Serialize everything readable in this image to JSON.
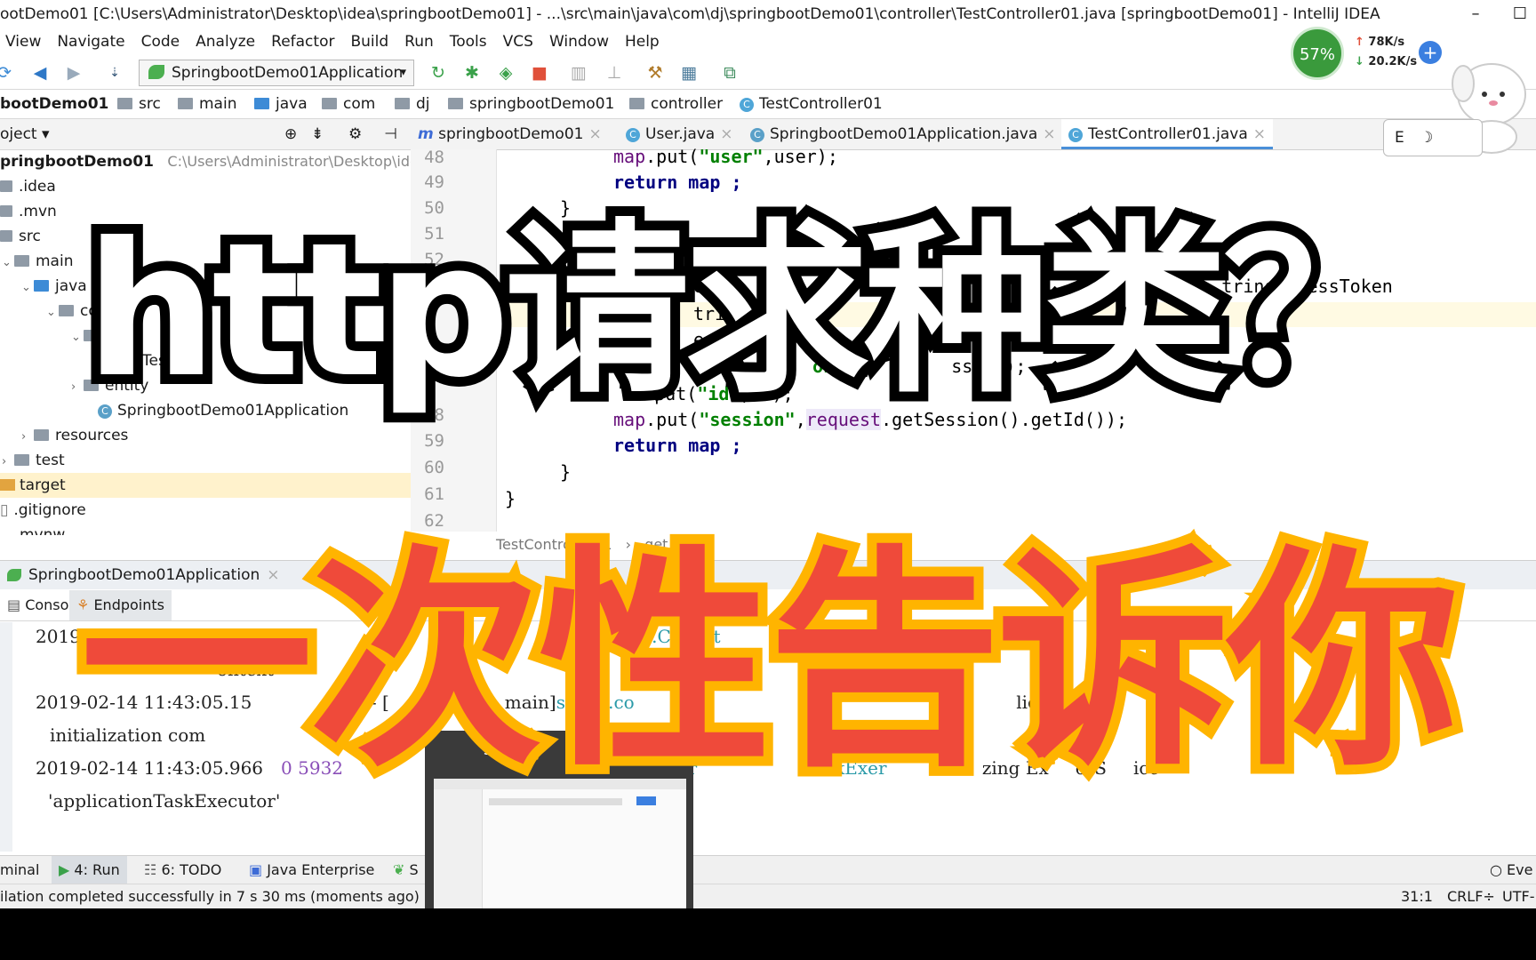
{
  "window": {
    "title": "ootDemo01 [C:\\Users\\Administrator\\Desktop\\idea\\springbootDemo01] - ...\\src\\main\\java\\com\\dj\\springbootDemo01\\controller\\TestController01.java [springbootDemo01] - IntelliJ IDEA"
  },
  "menu": [
    "View",
    "Navigate",
    "Code",
    "Analyze",
    "Refactor",
    "Build",
    "Run",
    "Tools",
    "VCS",
    "Window",
    "Help"
  ],
  "toolbar": {
    "run_config": "SpringbootDemo01Application"
  },
  "breadcrumbs": [
    "bootDemo01",
    "src",
    "main",
    "java",
    "com",
    "dj",
    "springbootDemo01",
    "controller",
    "TestController01"
  ],
  "project_panel": {
    "title": "oject",
    "tree": [
      {
        "label": "pringbootDemo01",
        "path": "C:\\Users\\Administrator\\Desktop\\ide"
      },
      {
        "label": ".idea"
      },
      {
        "label": ".mvn"
      },
      {
        "label": "src"
      },
      {
        "label": "main"
      },
      {
        "label": "java"
      },
      {
        "label": "co"
      },
      {
        "label": "ntro"
      },
      {
        "label": "Tes"
      },
      {
        "label": "entity"
      },
      {
        "label": "SpringbootDemo01Application"
      },
      {
        "label": "resources"
      },
      {
        "label": "test"
      },
      {
        "label": "target"
      },
      {
        "label": ".gitignore"
      },
      {
        "label": "mvnw"
      }
    ]
  },
  "editor": {
    "tabs": [
      "springbootDemo01",
      "User.java",
      "SpringbootDemo01Application.java",
      "TestController01.java"
    ],
    "active_tab": "TestController01.java",
    "line_numbers": [
      "48",
      "49",
      "50",
      "51",
      "52",
      "53",
      "54",
      "55",
      "56",
      "57",
      "58",
      "59",
      "60",
      "61",
      "62"
    ],
    "code": {
      "l48_a": "map",
      "l48_b": ".put(",
      "l48_c": "\"user\"",
      "l48_d": ",user);",
      "l49_kw": "return",
      "l49_b": " map ;",
      "l50": "}",
      "l52": "g(p",
      "l52_b": "He",
      "l53": "ect",
      "l53_b": "equ",
      "l53_c": "e",
      "l53_d": "tring",
      "l53_e": "essToken",
      "l54": "trin",
      "l54_b": "Ses",
      "l54_c": "ed",
      "l54_d": "t",
      "l55": "ear(",
      "l56": "t(",
      "l56_b": "oke",
      "l56_c": "ssi",
      "l56_d": ");",
      "l57_a": "ma",
      "l57_b": ".put(",
      "l57_c": "\"id\"",
      "l57_d": ",id);",
      "l58_a": "map",
      "l58_b": ".put(",
      "l58_c": "\"session\"",
      "l58_d": ",",
      "l58_e": "request",
      "l58_f": ".getSession().getId());",
      "l59_kw": "return",
      "l59_b": " map ;",
      "l60": "}",
      "l61": "}"
    },
    "method_crumb": [
      "TestController01",
      "get_h()"
    ]
  },
  "run_panel": {
    "title": "SpringbootDemo01Application",
    "tabs": [
      "Console",
      "Endpoints"
    ],
    "console": [
      {
        "a": "2019-02-14 11:43:05.15",
        "b": "5",
        "c": "a.c.c.C.",
        "d": "mcat",
        "e": "embe"
      },
      {
        "a": "ontext"
      },
      {
        "a": "2019-02-14 11:43:05.15",
        "b": "--- [",
        "c": "main]",
        "d": "s.web.co",
        "e": "r",
        "f": "lica",
        "g": "ex"
      },
      {
        "a": "initialization com",
        "b": "d",
        "c": "48"
      },
      {
        "a": "2019-02-14 11:43:05.966",
        "b": "0 5932",
        "c": "oncurr",
        "d": "TaskExe",
        "e": "r",
        "f": "nit",
        "g": "zing Ex",
        "h": "orS",
        "i": "ice"
      },
      {
        "a": "'applicationTaskExecutor'"
      }
    ]
  },
  "tool_strip": [
    "minal",
    "4: Run",
    "6: TODO",
    "Java Enterprise",
    "S",
    "Eve"
  ],
  "status": {
    "message": "ilation completed successfully in 7 s 30 ms (moments ago)",
    "position": "31:1",
    "line_sep": "CRLF",
    "encoding": "UTF-"
  },
  "net_widget": {
    "percent": "57%",
    "up": "78K/s",
    "down": "20.2K/s"
  },
  "popup": {
    "title": "stman"
  },
  "captions": {
    "top": "http请求种类？",
    "bottom": "一次性告诉你"
  }
}
